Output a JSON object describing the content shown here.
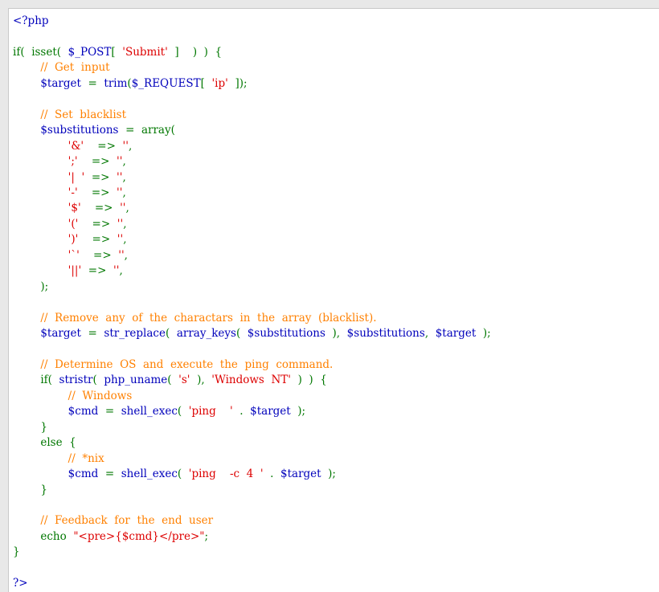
{
  "colors": {
    "keyword": "#007700",
    "default": "#0000bb",
    "string": "#dd0000",
    "comment": "#ff8000",
    "panel_background": "#ffffff",
    "window_background": "#e8e8e8"
  },
  "code": {
    "lines": [
      [
        {
          "t": "<?php",
          "c": "tag"
        }
      ],
      [],
      [
        {
          "t": "if(",
          "c": "kw"
        },
        {
          "t": "  ",
          "c": "kw"
        },
        {
          "t": "isset(",
          "c": "kw"
        },
        {
          "t": "  ",
          "c": "kw"
        },
        {
          "t": "$_POST",
          "c": "var"
        },
        {
          "t": "[  ",
          "c": "kw"
        },
        {
          "t": "'Submit'",
          "c": "str"
        },
        {
          "t": "  ]    )  )  {",
          "c": "kw"
        }
      ],
      [
        {
          "t": "        ",
          "c": "kw"
        },
        {
          "t": "//  Get  input",
          "c": "cmt"
        }
      ],
      [
        {
          "t": "        ",
          "c": "kw"
        },
        {
          "t": "$target",
          "c": "var"
        },
        {
          "t": "  =  ",
          "c": "kw"
        },
        {
          "t": "trim",
          "c": "var"
        },
        {
          "t": "(",
          "c": "kw"
        },
        {
          "t": "$_REQUEST",
          "c": "var"
        },
        {
          "t": "[  ",
          "c": "kw"
        },
        {
          "t": "'ip'",
          "c": "str"
        },
        {
          "t": "  ]);",
          "c": "kw"
        }
      ],
      [],
      [
        {
          "t": "        ",
          "c": "kw"
        },
        {
          "t": "//  Set  blacklist",
          "c": "cmt"
        }
      ],
      [
        {
          "t": "        ",
          "c": "kw"
        },
        {
          "t": "$substitutions",
          "c": "var"
        },
        {
          "t": "  =  ",
          "c": "kw"
        },
        {
          "t": "array(",
          "c": "kw"
        }
      ],
      [
        {
          "t": "                ",
          "c": "kw"
        },
        {
          "t": "'&'",
          "c": "str"
        },
        {
          "t": "    =>  ",
          "c": "kw"
        },
        {
          "t": "''",
          "c": "str"
        },
        {
          "t": ",",
          "c": "kw"
        }
      ],
      [
        {
          "t": "                ",
          "c": "kw"
        },
        {
          "t": "';'",
          "c": "str"
        },
        {
          "t": "    =>  ",
          "c": "kw"
        },
        {
          "t": "''",
          "c": "str"
        },
        {
          "t": ",",
          "c": "kw"
        }
      ],
      [
        {
          "t": "                ",
          "c": "kw"
        },
        {
          "t": "'|  '",
          "c": "str"
        },
        {
          "t": "  =>  ",
          "c": "kw"
        },
        {
          "t": "''",
          "c": "str"
        },
        {
          "t": ",",
          "c": "kw"
        }
      ],
      [
        {
          "t": "                ",
          "c": "kw"
        },
        {
          "t": "'-'",
          "c": "str"
        },
        {
          "t": "    =>  ",
          "c": "kw"
        },
        {
          "t": "''",
          "c": "str"
        },
        {
          "t": ",",
          "c": "kw"
        }
      ],
      [
        {
          "t": "                ",
          "c": "kw"
        },
        {
          "t": "'$'",
          "c": "str"
        },
        {
          "t": "    =>  ",
          "c": "kw"
        },
        {
          "t": "''",
          "c": "str"
        },
        {
          "t": ",",
          "c": "kw"
        }
      ],
      [
        {
          "t": "                ",
          "c": "kw"
        },
        {
          "t": "'('",
          "c": "str"
        },
        {
          "t": "    =>  ",
          "c": "kw"
        },
        {
          "t": "''",
          "c": "str"
        },
        {
          "t": ",",
          "c": "kw"
        }
      ],
      [
        {
          "t": "                ",
          "c": "kw"
        },
        {
          "t": "')'",
          "c": "str"
        },
        {
          "t": "    =>  ",
          "c": "kw"
        },
        {
          "t": "''",
          "c": "str"
        },
        {
          "t": ",",
          "c": "kw"
        }
      ],
      [
        {
          "t": "                ",
          "c": "kw"
        },
        {
          "t": "'`'",
          "c": "str"
        },
        {
          "t": "    =>  ",
          "c": "kw"
        },
        {
          "t": "''",
          "c": "str"
        },
        {
          "t": ",",
          "c": "kw"
        }
      ],
      [
        {
          "t": "                ",
          "c": "kw"
        },
        {
          "t": "'||'",
          "c": "str"
        },
        {
          "t": "  =>  ",
          "c": "kw"
        },
        {
          "t": "''",
          "c": "str"
        },
        {
          "t": ",",
          "c": "kw"
        }
      ],
      [
        {
          "t": "        );",
          "c": "kw"
        }
      ],
      [],
      [
        {
          "t": "        ",
          "c": "kw"
        },
        {
          "t": "//  Remove  any  of  the  charactars  in  the  array  (blacklist).",
          "c": "cmt"
        }
      ],
      [
        {
          "t": "        ",
          "c": "kw"
        },
        {
          "t": "$target",
          "c": "var"
        },
        {
          "t": "  =  ",
          "c": "kw"
        },
        {
          "t": "str_replace",
          "c": "var"
        },
        {
          "t": "(  ",
          "c": "kw"
        },
        {
          "t": "array_keys",
          "c": "var"
        },
        {
          "t": "(  ",
          "c": "kw"
        },
        {
          "t": "$substitutions",
          "c": "var"
        },
        {
          "t": "  ),  ",
          "c": "kw"
        },
        {
          "t": "$substitutions",
          "c": "var"
        },
        {
          "t": ",  ",
          "c": "kw"
        },
        {
          "t": "$target",
          "c": "var"
        },
        {
          "t": "  );",
          "c": "kw"
        }
      ],
      [],
      [
        {
          "t": "        ",
          "c": "kw"
        },
        {
          "t": "//  Determine  OS  and  execute  the  ping  command.",
          "c": "cmt"
        }
      ],
      [
        {
          "t": "        ",
          "c": "kw"
        },
        {
          "t": "if(",
          "c": "kw"
        },
        {
          "t": "  ",
          "c": "kw"
        },
        {
          "t": "stristr",
          "c": "var"
        },
        {
          "t": "(  ",
          "c": "kw"
        },
        {
          "t": "php_uname",
          "c": "var"
        },
        {
          "t": "(  ",
          "c": "kw"
        },
        {
          "t": "'s'",
          "c": "str"
        },
        {
          "t": "  ),  ",
          "c": "kw"
        },
        {
          "t": "'Windows  NT'",
          "c": "str"
        },
        {
          "t": "  )  )  {",
          "c": "kw"
        }
      ],
      [
        {
          "t": "                ",
          "c": "kw"
        },
        {
          "t": "//  Windows",
          "c": "cmt"
        }
      ],
      [
        {
          "t": "                ",
          "c": "kw"
        },
        {
          "t": "$cmd",
          "c": "var"
        },
        {
          "t": "  =  ",
          "c": "kw"
        },
        {
          "t": "shell_exec",
          "c": "var"
        },
        {
          "t": "(  ",
          "c": "kw"
        },
        {
          "t": "'ping    '",
          "c": "str"
        },
        {
          "t": "  .  ",
          "c": "kw"
        },
        {
          "t": "$target",
          "c": "var"
        },
        {
          "t": "  );",
          "c": "kw"
        }
      ],
      [
        {
          "t": "        }",
          "c": "kw"
        }
      ],
      [
        {
          "t": "        else  {",
          "c": "kw"
        }
      ],
      [
        {
          "t": "                ",
          "c": "kw"
        },
        {
          "t": "//  *nix",
          "c": "cmt"
        }
      ],
      [
        {
          "t": "                ",
          "c": "kw"
        },
        {
          "t": "$cmd",
          "c": "var"
        },
        {
          "t": "  =  ",
          "c": "kw"
        },
        {
          "t": "shell_exec",
          "c": "var"
        },
        {
          "t": "(  ",
          "c": "kw"
        },
        {
          "t": "'ping    -c  4  '",
          "c": "str"
        },
        {
          "t": "  .  ",
          "c": "kw"
        },
        {
          "t": "$target",
          "c": "var"
        },
        {
          "t": "  );",
          "c": "kw"
        }
      ],
      [
        {
          "t": "        }",
          "c": "kw"
        }
      ],
      [],
      [
        {
          "t": "        ",
          "c": "kw"
        },
        {
          "t": "//  Feedback  for  the  end  user",
          "c": "cmt"
        }
      ],
      [
        {
          "t": "        ",
          "c": "kw"
        },
        {
          "t": "echo",
          "c": "kw"
        },
        {
          "t": "  ",
          "c": "kw"
        },
        {
          "t": "\"<pre>{$cmd}</pre>\"",
          "c": "str"
        },
        {
          "t": ";",
          "c": "kw"
        }
      ],
      [
        {
          "t": "}",
          "c": "kw"
        }
      ],
      [],
      [
        {
          "t": "?>",
          "c": "tag"
        }
      ]
    ]
  }
}
